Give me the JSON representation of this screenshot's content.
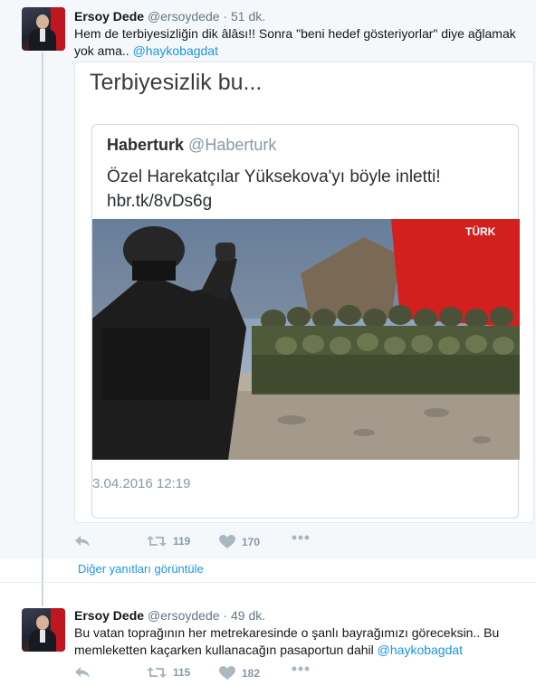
{
  "tweet1": {
    "fullname": "Ersoy Dede",
    "username": "@ersoydede",
    "dot": "·",
    "time": "51 dk.",
    "text_line1": "Hem de terbiyesizliğin dik âlâsı!! Sonra \"beni hedef gösteriyorlar\" diye ağlamak",
    "text_line2": "yok ama.. ",
    "mention": "@haykobagdat",
    "media": {
      "caption": "Terbiyesizlik bu...",
      "quote_name": "Haberturk",
      "quote_username": "@Haberturk",
      "quote_line1": "Özel Harekatçılar Yüksekova'yı böyle inletti!",
      "quote_line2": "hbr.tk/8vDs6g",
      "photo_watermark": "TÜRK",
      "quote_date": "3.04.2016 12:19"
    },
    "retweets": "119",
    "likes": "170"
  },
  "more_replies": "Diğer yanıtları görüntüle",
  "tweet2": {
    "fullname": "Ersoy Dede",
    "username": "@ersoydede",
    "dot": "·",
    "time": "49 dk.",
    "text_line1": "Bu vatan toprağının her metrekaresinde o şanlı bayrağımızı göreceksin.. Bu",
    "text_line2": "memleketten kaçarken kullanacağın pasaportun dahil ",
    "mention": "@haykobagdat",
    "retweets": "115",
    "likes": "182"
  },
  "icons": [
    "reply-icon",
    "retweet-icon",
    "heart-icon",
    "more-icon"
  ],
  "colors": {
    "link": "#1b95e0",
    "meta": "#657786",
    "action": "#aab8c2",
    "flag_red": "#c0161f"
  }
}
